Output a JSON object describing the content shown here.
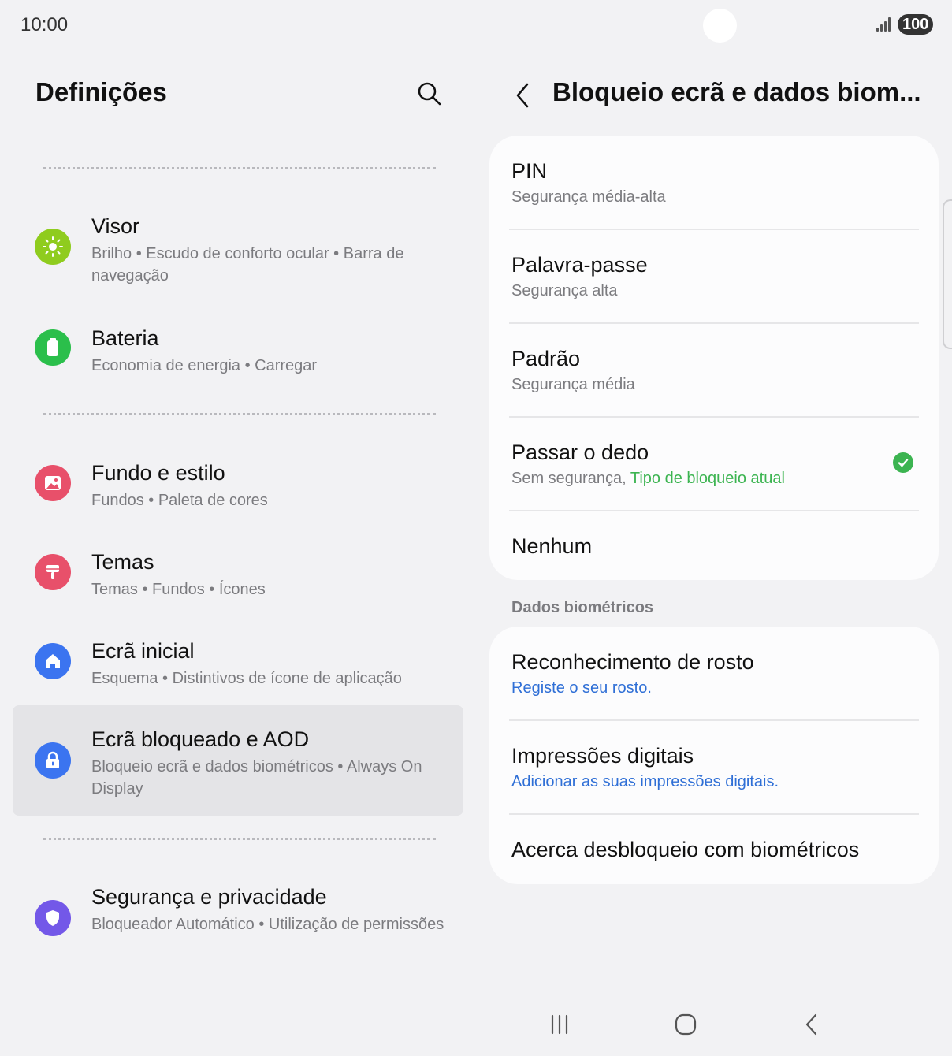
{
  "status_bar": {
    "time": "10:00",
    "battery": "100",
    "icons": [
      "signal-icon",
      "battery-icon"
    ]
  },
  "left": {
    "title": "Definições",
    "search_icon": "search-icon",
    "items": [
      {
        "icon": "sun-icon",
        "color": "#8fcc1e",
        "name": "Visor",
        "sub": "Brilho  •  Escudo de conforto ocular  •  Barra de navegação"
      },
      {
        "icon": "battery-icon",
        "color": "#2bbf4b",
        "name": "Bateria",
        "sub": "Economia de energia  •  Carregar"
      },
      {
        "icon": "image-icon",
        "color": "#e8506a",
        "name": "Fundo e estilo",
        "sub": "Fundos  •  Paleta de cores"
      },
      {
        "icon": "brush-icon",
        "color": "#e8506a",
        "name": "Temas",
        "sub": "Temas  •  Fundos  •  Ícones"
      },
      {
        "icon": "home-icon",
        "color": "#3b74f0",
        "name": "Ecrã inicial",
        "sub": "Esquema  •  Distintivos de ícone de aplicação"
      },
      {
        "icon": "lock-icon",
        "color": "#3b74f0",
        "name": "Ecrã bloqueado e AOD",
        "sub": "Bloqueio ecrã e dados biométricos  •  Always On Display",
        "selected": true
      },
      {
        "icon": "shield-icon",
        "color": "#7358e8",
        "name": "Segurança e privacidade",
        "sub": "Bloqueador Automático  •  Utilização de permissões"
      }
    ]
  },
  "right": {
    "title": "Bloqueio ecrã e dados biom...",
    "back_icon": "back-arrow-icon",
    "lock_types": [
      {
        "name": "PIN",
        "sub": "Segurança média-alta"
      },
      {
        "name": "Palavra-passe",
        "sub": "Segurança alta"
      },
      {
        "name": "Padrão",
        "sub": "Segurança média"
      },
      {
        "name": "Passar o dedo",
        "sub": "Sem segurança,",
        "sub_extra": "Tipo de bloqueio atual",
        "checked": true
      },
      {
        "name": "Nenhum"
      }
    ],
    "section_label": "Dados biométricos",
    "biometrics": [
      {
        "name": "Reconhecimento de rosto",
        "sub": "Registe o seu rosto."
      },
      {
        "name": "Impressões digitais",
        "sub": "Adicionar as suas impressões digitais."
      },
      {
        "name": "Acerca desbloqueio com biométricos"
      }
    ],
    "accent_green": "#3cb451",
    "accent_blue": "#2f6fd6"
  },
  "nav_bar": {
    "icons": [
      "recent-apps-icon",
      "home-button-icon",
      "back-icon"
    ]
  }
}
